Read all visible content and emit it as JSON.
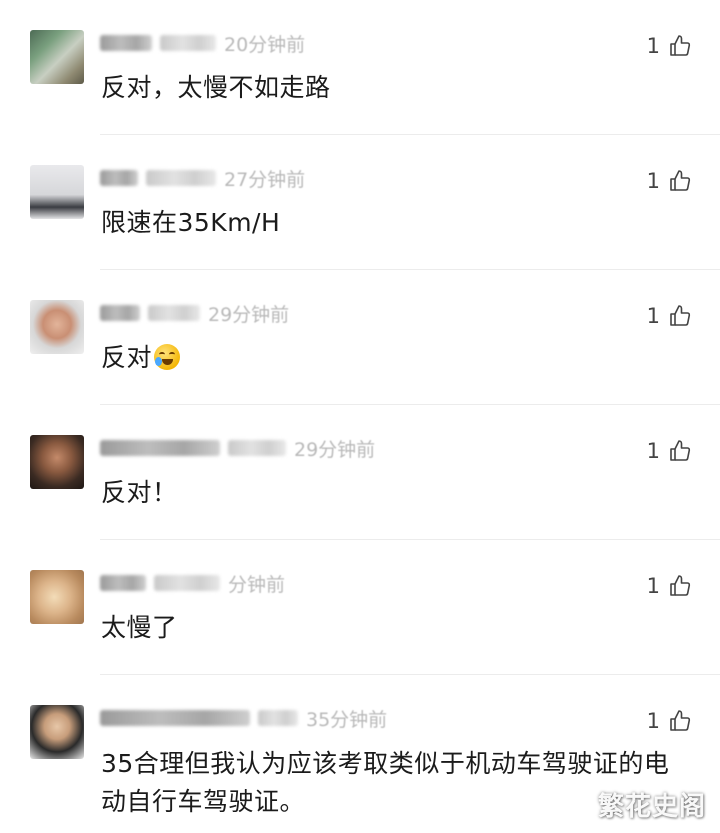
{
  "comments": [
    {
      "meta_time": "20分钟前",
      "text": "反对，太慢不如走路",
      "likes": "1"
    },
    {
      "meta_time": "27分钟前",
      "text": "限速在35Km/H",
      "likes": "1"
    },
    {
      "meta_time": "29分钟前",
      "text": "反对",
      "likes": "1"
    },
    {
      "meta_time": "29分钟前",
      "text": "反对！",
      "likes": "1"
    },
    {
      "meta_time": "分钟前",
      "text": "太慢了",
      "likes": "1"
    },
    {
      "meta_time": "35分钟前",
      "text": "35合理但我认为应该考取类似于机动车驾驶证的电动自行车驾驶证。",
      "likes": "1"
    }
  ],
  "icons": {
    "like": "thumbs-up-icon",
    "emoji": "crying-laughing-emoji-icon"
  },
  "watermark": "繁花史阁",
  "colors": {
    "text": "#1b1b1b",
    "meta": "#b9b9b9",
    "divider": "#ececec",
    "like": "#444444"
  }
}
